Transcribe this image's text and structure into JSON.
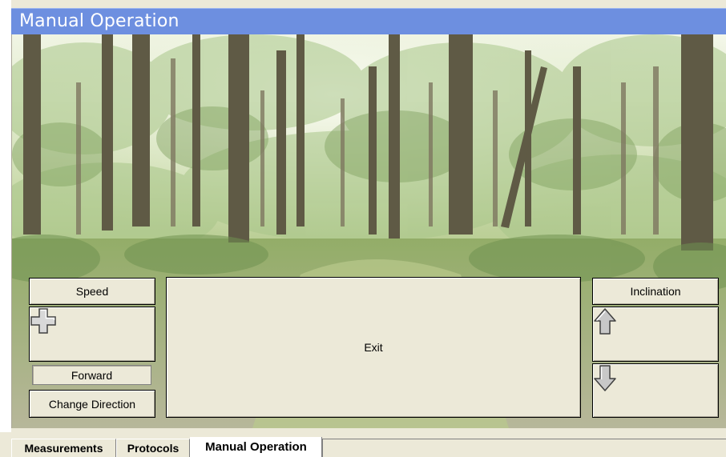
{
  "window": {
    "title": "Manual Operation"
  },
  "controls": {
    "speed_label": "Speed",
    "speed_increase_icon": "plus-icon",
    "direction_status": "Forward",
    "change_direction_label": "Change Direction",
    "exit_label": "Exit",
    "inclination_label": "Inclination",
    "inclination_up_icon": "arrow-up-icon",
    "inclination_down_icon": "arrow-down-icon"
  },
  "background": {
    "description_icon": "forest-image"
  },
  "tabs": [
    {
      "label": "Measurements",
      "active": false
    },
    {
      "label": "Protocols",
      "active": false
    },
    {
      "label": "Manual Operation",
      "active": true
    }
  ]
}
